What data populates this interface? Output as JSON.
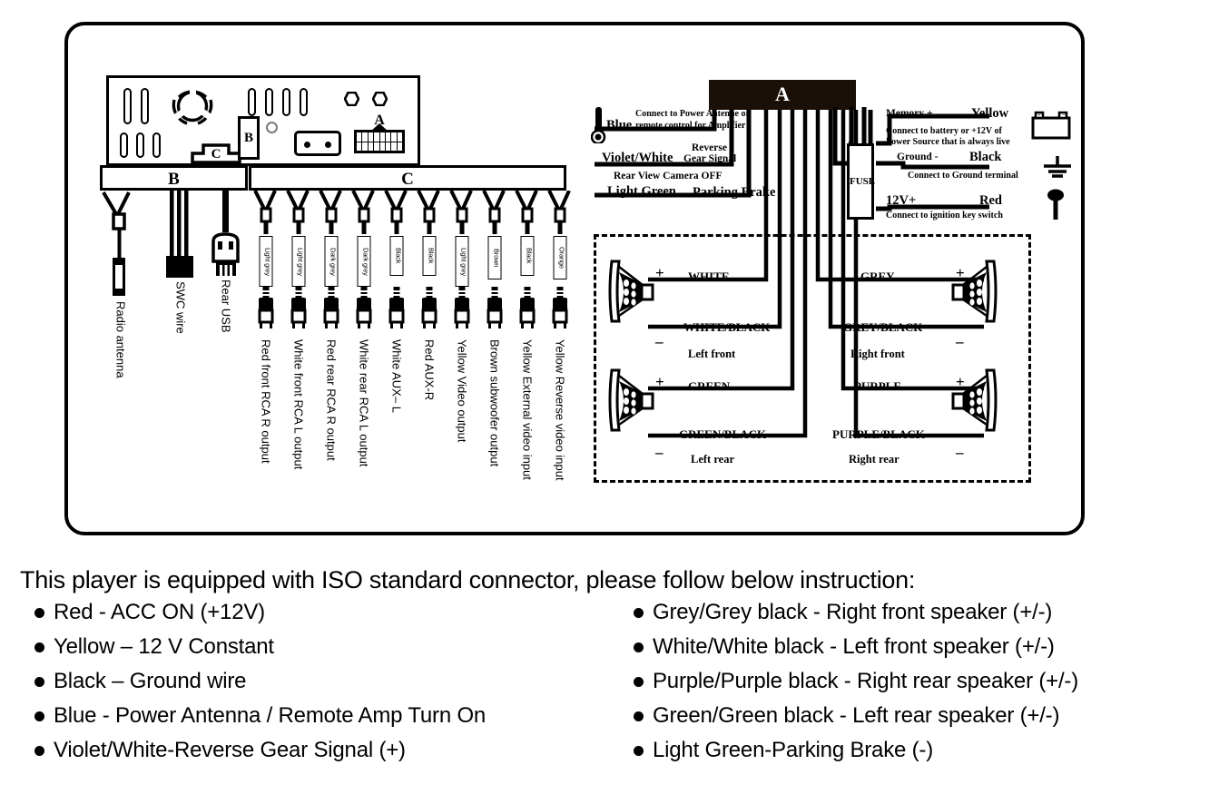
{
  "diagram": {
    "unit": {
      "connector_a_label": "A",
      "connector_b_label": "B",
      "connector_c_label": "C",
      "harness_b_label": "B",
      "harness_c_label": "C"
    },
    "b_cables": [
      {
        "name": "radio-antenna",
        "desc": "Radio antenna"
      },
      {
        "name": "swc-wire",
        "desc": "SWC wire"
      },
      {
        "name": "rear-usb",
        "desc": "Rear  USB"
      }
    ],
    "c_cables": [
      {
        "name": "red-front-rca-r",
        "tag": "Light grey",
        "desc": "Red  front RCA R output"
      },
      {
        "name": "white-front-rca-l",
        "tag": "Light grey",
        "desc": "White front RCA L output"
      },
      {
        "name": "red-rear-rca-r",
        "tag": "Dark grey",
        "desc": "Red  rear RCA R output"
      },
      {
        "name": "white-rear-rca-l",
        "tag": "Dark grey",
        "desc": "White rear RCA L output"
      },
      {
        "name": "aux-l",
        "tag": "Black",
        "desc": "White   AUX– L"
      },
      {
        "name": "aux-r",
        "tag": "Black",
        "desc": "Red   AUX-R"
      },
      {
        "name": "video-output",
        "tag": "Light grey",
        "desc": "Yellow Video output"
      },
      {
        "name": "subwoofer-output",
        "tag": "Brown",
        "desc": "Brown subwoofer output"
      },
      {
        "name": "external-video-input",
        "tag": "Black",
        "desc": "Yellow External video input"
      },
      {
        "name": "reverse-video-input",
        "tag": "Orange",
        "desc": "Yellow Reverse video input"
      }
    ],
    "connector_a": {
      "bar_label": "A",
      "fuse_label": "FUSE",
      "signals": [
        {
          "name": "blue-antenna-remote",
          "color": "Blue",
          "note_line1": "Connect to Power Antenne or",
          "note_line2": "remote control for Amplifier"
        },
        {
          "name": "violet-white-reverse",
          "color": "Violet/White",
          "func_line1": "Reverse",
          "func_line2": "Gear Signal",
          "note": "Rear View Camera OFF"
        },
        {
          "name": "light-green-parking",
          "color": "Light Green",
          "func": "Parking Brake"
        }
      ],
      "power": [
        {
          "name": "memory-plus",
          "left": "Memory +",
          "right": "Yellow",
          "note_line1": "Connect to battery or  +12V of",
          "note_line2": "Power Source that is always live"
        },
        {
          "name": "ground",
          "left": "Ground -",
          "right": "Black",
          "note_line1": "Connect to Ground terminal",
          "note_line2": ""
        },
        {
          "name": "acc-12v",
          "left": "12V+",
          "right": "Red",
          "note_line1": "Connect to ignition key switch",
          "note_line2": ""
        }
      ]
    },
    "speakers": [
      {
        "name": "left-front",
        "pos_wire": "WHITE",
        "neg_wire": "WHITE/BLACK",
        "position": "Left front",
        "plus": "+",
        "minus": "–"
      },
      {
        "name": "right-front",
        "pos_wire": "GREY",
        "neg_wire": "GREY/BLACK",
        "position": "Right front",
        "plus": "+",
        "minus": "–"
      },
      {
        "name": "left-rear",
        "pos_wire": "GREEN",
        "neg_wire": "GREEN/BLACK",
        "position": "Left rear",
        "plus": "+",
        "minus": "–"
      },
      {
        "name": "right-rear",
        "pos_wire": "PURPLE",
        "neg_wire": "PURPLE/BLACK",
        "position": "Right rear",
        "plus": "+",
        "minus": "–"
      }
    ]
  },
  "instructions": {
    "intro": "This player is equipped with ISO standard connector, please follow below instruction:",
    "left_items": [
      "Red - ACC ON (+12V)",
      "Yellow – 12 V Constant",
      "Black – Ground wire",
      "Blue - Power Antenna / Remote Amp Turn On",
      "Violet/White-Reverse Gear Signal (+)"
    ],
    "right_items": [
      "Grey/Grey black - Right front speaker (+/-)",
      "White/White black - Left front speaker (+/-)",
      "Purple/Purple black - Right rear speaker (+/-)",
      "Green/Green black - Left rear speaker (+/-)",
      "Light Green-Parking Brake (-)"
    ]
  },
  "colors": {
    "ink": "#000000",
    "paper": "#ffffff"
  }
}
